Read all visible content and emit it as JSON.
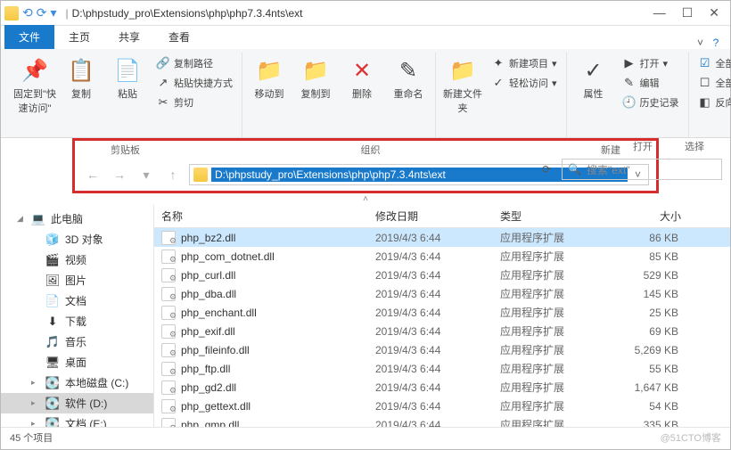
{
  "window": {
    "title_path": "D:\\phpstudy_pro\\Extensions\\php\\php7.3.4nts\\ext",
    "separator": "|"
  },
  "tabs": {
    "file": "文件",
    "home": "主页",
    "share": "共享",
    "view": "查看"
  },
  "ribbon": {
    "clipboard": {
      "pin": "固定到\"快速访问\"",
      "copy": "复制",
      "paste": "粘贴",
      "copy_path": "复制路径",
      "paste_shortcut": "粘贴快捷方式",
      "cut": "剪切",
      "label": "剪贴板"
    },
    "organize": {
      "move_to": "移动到",
      "copy_to": "复制到",
      "delete": "删除",
      "rename": "重命名",
      "label": "组织"
    },
    "new": {
      "new_folder": "新建文件夹",
      "new_item": "新建项目",
      "easy_access": "轻松访问",
      "label": "新建"
    },
    "open": {
      "properties": "属性",
      "open": "打开",
      "edit": "编辑",
      "history": "历史记录",
      "label": "打开"
    },
    "select": {
      "select_all": "全部选择",
      "select_none": "全部取消",
      "invert": "反向选择",
      "label": "选择"
    }
  },
  "address": {
    "path": "D:\\phpstudy_pro\\Extensions\\php\\php7.3.4nts\\ext",
    "search_placeholder": "搜索\"ext\""
  },
  "columns": {
    "name": "名称",
    "date": "修改日期",
    "type": "类型",
    "size": "大小"
  },
  "sidebar": {
    "this_pc": "此电脑",
    "items": [
      {
        "icon": "🧊",
        "label": "3D 对象"
      },
      {
        "icon": "🎬",
        "label": "视频"
      },
      {
        "icon": "🖼",
        "label": "图片"
      },
      {
        "icon": "📄",
        "label": "文档"
      },
      {
        "icon": "⬇",
        "label": "下载"
      },
      {
        "icon": "🎵",
        "label": "音乐"
      },
      {
        "icon": "🖥",
        "label": "桌面"
      },
      {
        "icon": "💽",
        "label": "本地磁盘 (C:)"
      },
      {
        "icon": "💽",
        "label": "软件 (D:)"
      },
      {
        "icon": "💽",
        "label": "文档 (E:)"
      }
    ]
  },
  "files": [
    {
      "name": "php_bz2.dll",
      "date": "2019/4/3 6:44",
      "type": "应用程序扩展",
      "size": "86 KB",
      "selected": true
    },
    {
      "name": "php_com_dotnet.dll",
      "date": "2019/4/3 6:44",
      "type": "应用程序扩展",
      "size": "85 KB"
    },
    {
      "name": "php_curl.dll",
      "date": "2019/4/3 6:44",
      "type": "应用程序扩展",
      "size": "529 KB"
    },
    {
      "name": "php_dba.dll",
      "date": "2019/4/3 6:44",
      "type": "应用程序扩展",
      "size": "145 KB"
    },
    {
      "name": "php_enchant.dll",
      "date": "2019/4/3 6:44",
      "type": "应用程序扩展",
      "size": "25 KB"
    },
    {
      "name": "php_exif.dll",
      "date": "2019/4/3 6:44",
      "type": "应用程序扩展",
      "size": "69 KB"
    },
    {
      "name": "php_fileinfo.dll",
      "date": "2019/4/3 6:44",
      "type": "应用程序扩展",
      "size": "5,269 KB"
    },
    {
      "name": "php_ftp.dll",
      "date": "2019/4/3 6:44",
      "type": "应用程序扩展",
      "size": "55 KB"
    },
    {
      "name": "php_gd2.dll",
      "date": "2019/4/3 6:44",
      "type": "应用程序扩展",
      "size": "1,647 KB"
    },
    {
      "name": "php_gettext.dll",
      "date": "2019/4/3 6:44",
      "type": "应用程序扩展",
      "size": "54 KB"
    },
    {
      "name": "php_gmp.dll",
      "date": "2019/4/3 6:44",
      "type": "应用程序扩展",
      "size": "335 KB"
    }
  ],
  "status": {
    "count": "45 个项目",
    "watermark": "@51CTO博客"
  }
}
